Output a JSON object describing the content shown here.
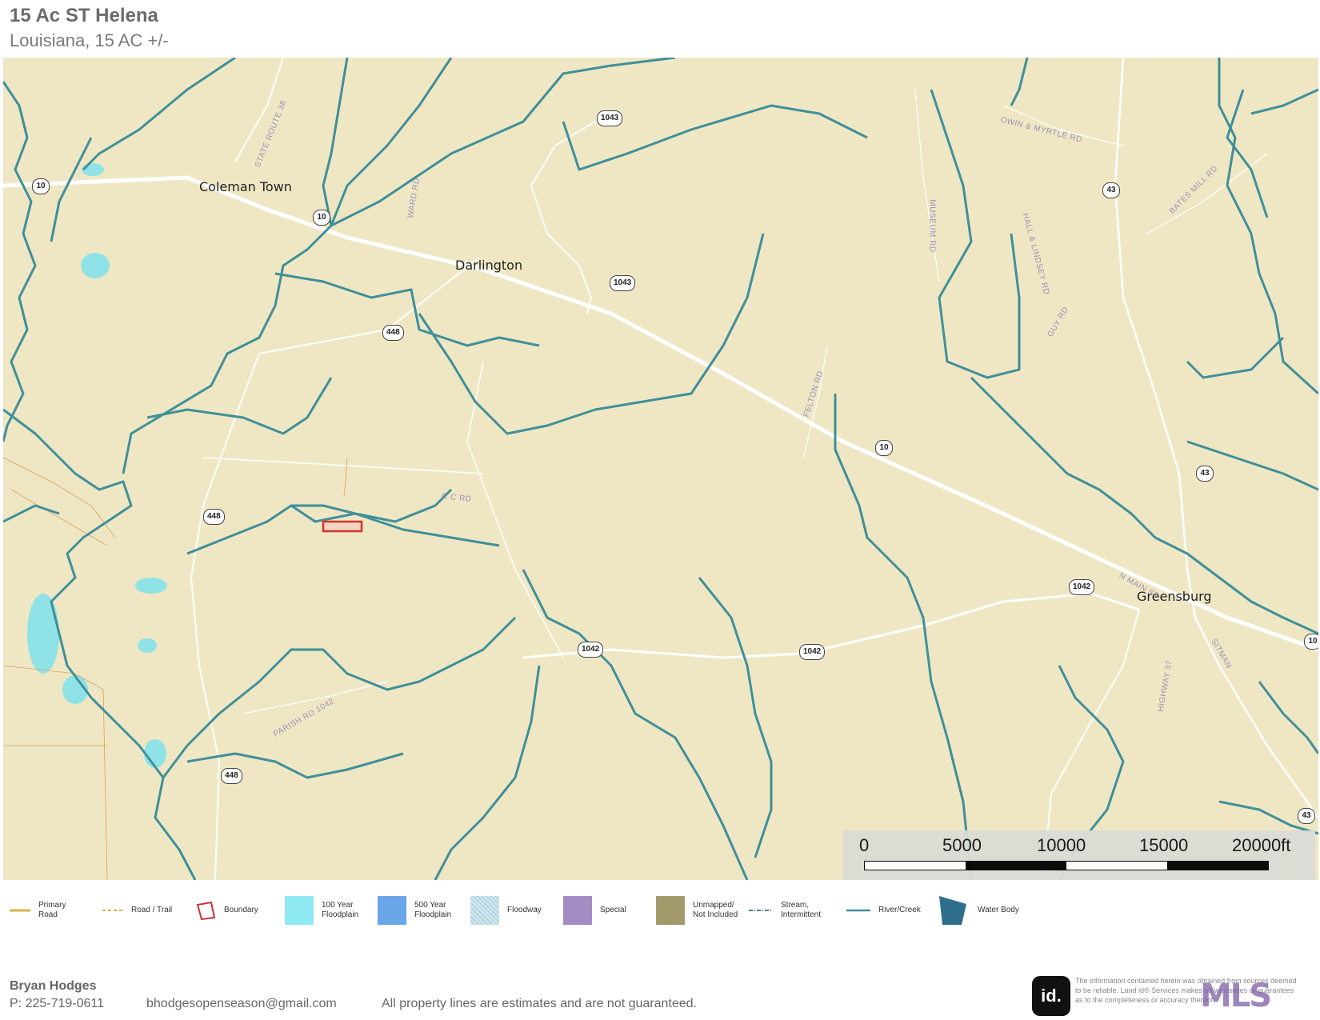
{
  "header": {
    "title": "15 Ac ST Helena",
    "subtitle": "Louisiana, 15 AC +/-"
  },
  "map": {
    "places": [
      "Coleman Town",
      "Darlington",
      "Greensburg"
    ],
    "road_labels": [
      "STATE ROUTE 38",
      "WARD RD",
      "MUSEUM RD",
      "HALL & LINDSEY RD",
      "GUY RD",
      "FELTON RD",
      "BATES MILL RD",
      "OWIN & MYRTLE RD",
      "C C RD",
      "PARISH RD 1042",
      "HIGHWAY 37",
      "N MAIN ST",
      "SITMAN"
    ],
    "shields": [
      "10",
      "10",
      "1043",
      "1043",
      "448",
      "448",
      "448",
      "10",
      "43",
      "43",
      "43",
      "1042",
      "1042",
      "1042",
      "10"
    ],
    "colors": {
      "land": "#efe7c4",
      "river": "#3f8f99",
      "road": "#ffffff",
      "parcel": "#d2342a"
    }
  },
  "scale": {
    "ticks": [
      "0",
      "5000",
      "10000",
      "15000",
      "20000ft"
    ]
  },
  "legend": [
    {
      "label": "Primary Road",
      "icon": "primary-road-icon"
    },
    {
      "label": "Road / Trail",
      "icon": "road-trail-icon"
    },
    {
      "label": "Boundary",
      "icon": "boundary-icon"
    },
    {
      "label": "100 Year Floodplain",
      "icon": "floodplain-100-icon"
    },
    {
      "label": "500 Year Floodplain",
      "icon": "floodplain-500-icon"
    },
    {
      "label": "Floodway",
      "icon": "floodway-icon"
    },
    {
      "label": "Special",
      "icon": "special-icon"
    },
    {
      "label": "Unmapped/ Not Included",
      "icon": "unmapped-icon"
    },
    {
      "label": "Stream, Intermittent",
      "icon": "stream-icon"
    },
    {
      "label": "River/Creek",
      "icon": "river-icon"
    },
    {
      "label": "Water Body",
      "icon": "water-body-icon"
    }
  ],
  "footer": {
    "name": "Bryan Hodges",
    "phone": "P: 225-719-0611",
    "email": "bhodgesopenseason@gmail.com",
    "note": "All property lines are estimates and are not guaranteed.",
    "disclaimer": "The information contained herein was obtained from sources deemed to be reliable. Land id® Services makes no warranties or guarantees as to the completeness or accuracy thereof.",
    "logo_text": "id.",
    "mls_text": "MLS"
  }
}
